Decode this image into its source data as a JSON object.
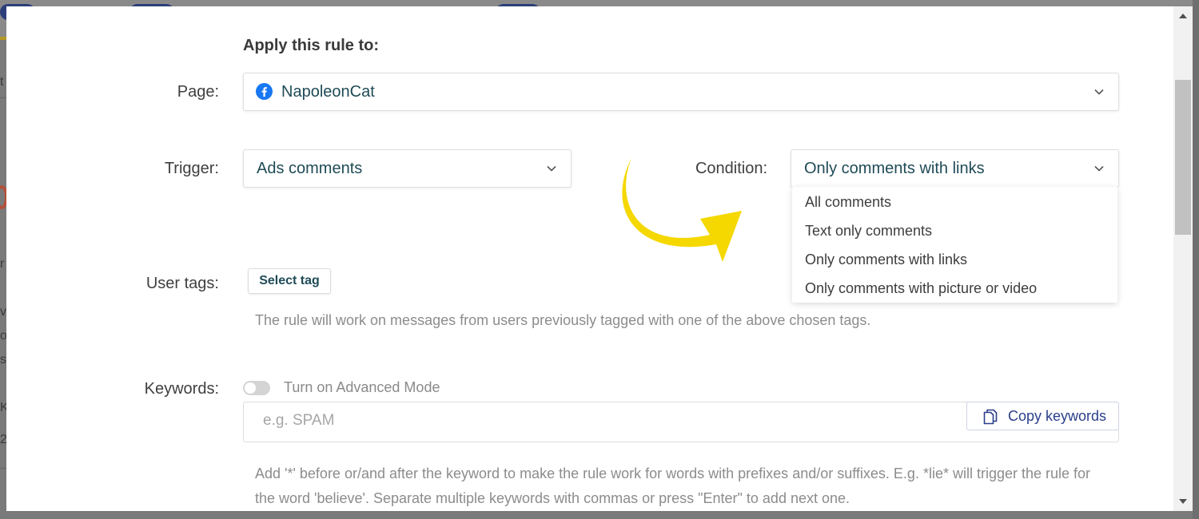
{
  "modal": {
    "section_title": "Apply this rule to:",
    "page": {
      "label": "Page:",
      "value": "NapoleonCat",
      "icon": "facebook-icon"
    },
    "trigger": {
      "label": "Trigger:",
      "value": "Ads comments"
    },
    "condition": {
      "label": "Condition:",
      "value": "Only comments with links",
      "options": [
        "All comments",
        "Text only comments",
        "Only comments with links",
        "Only comments with picture or video"
      ]
    },
    "user_tags": {
      "label": "User tags:",
      "button": "Select tag",
      "hint": "The rule will work on messages from users previously tagged with one of the above chosen tags."
    },
    "keywords": {
      "label": "Keywords:",
      "toggle_label": "Turn on Advanced Mode",
      "placeholder": "e.g. SPAM",
      "copy_button": "Copy keywords",
      "help": "Add '*' before or/and after the keyword to make the rule work for words with prefixes and/or suffixes. E.g. *lie* will trigger the rule for the word 'believe'. Separate multiple keywords with commas or press \"Enter\" to add next one."
    }
  },
  "background": {
    "letters": [
      "t",
      "r",
      "v",
      "ov",
      "se",
      "Ke",
      "2"
    ]
  },
  "colors": {
    "accent_text": "#1f4b57",
    "link_blue": "#2a3f8a",
    "facebook_blue": "#1877f2",
    "annotation_arrow": "#f5d800"
  }
}
